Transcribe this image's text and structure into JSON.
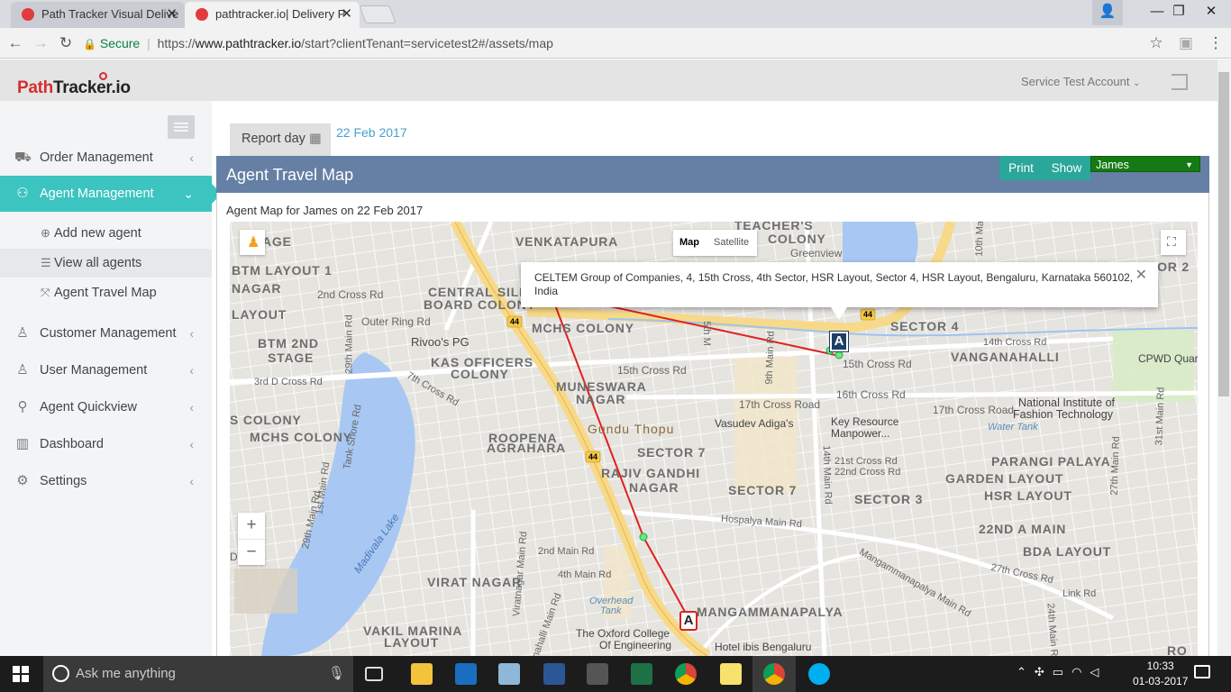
{
  "browser": {
    "tabs": [
      {
        "title": "Path Tracker Visual Delive",
        "active": false
      },
      {
        "title": "pathtracker.io| Delivery P",
        "active": true
      }
    ],
    "secure_label": "Secure",
    "url_scheme": "https://",
    "url_host": "www.pathtracker.io",
    "url_path": "/start?clientTenant=servicetest2#/assets/map"
  },
  "header": {
    "logo_path": "Path",
    "logo_tracker": "Tracker",
    "logo_io": ".io",
    "account": "Service Test Account"
  },
  "sidebar": {
    "items": [
      {
        "label": "Order Management",
        "icon": "truck-icon"
      },
      {
        "label": "Agent Management",
        "icon": "agents-icon",
        "active": true
      },
      {
        "label": "Customer Management",
        "icon": "user-icon"
      },
      {
        "label": "User Management",
        "icon": "user-icon"
      },
      {
        "label": "Agent Quickview",
        "icon": "motorbike-icon"
      },
      {
        "label": "Dashboard",
        "icon": "bar-chart-icon"
      },
      {
        "label": "Settings",
        "icon": "gear-icon"
      }
    ],
    "subitems": [
      {
        "label": "Add new agent",
        "icon": "plus-circle-icon"
      },
      {
        "label": "View all agents",
        "icon": "list-icon"
      },
      {
        "label": "Agent Travel Map",
        "icon": "expand-icon"
      }
    ]
  },
  "report": {
    "label": "Report day",
    "date": "22 Feb 2017"
  },
  "panel": {
    "title": "Agent Travel Map",
    "print": "Print",
    "show": "Show",
    "agent_selected": "James",
    "subtitle": "Agent Map for James on 22 Feb 2017"
  },
  "map": {
    "type_map": "Map",
    "type_satellite": "Satellite",
    "infowindow": "CELTEM Group of Companies, 4, 15th Cross, 4th Sector, HSR Layout, Sector 4, HSR Layout, Bengaluru, Karnataka 560102, India",
    "marker_label": "A",
    "road_badge": "44",
    "route_color": "#e02020",
    "labels": {
      "venkatapura": "VENKATAPURA",
      "teachers": "TEACHER'S",
      "colony1": "COLONY",
      "greenview": "Greenview",
      "btm1": "BTM LAYOUT 1",
      "nagar1": "NAGAR",
      "layout1": "LAYOUT",
      "age": "AGE",
      "central_silk": "CENTRAL SILK",
      "board_colony": "BOARD COLONY",
      "mchs1": "MCHS COLONY",
      "sector4": "SECTOR 4",
      "sector2": "TOR 2",
      "btm2": "BTM 2ND",
      "stage": "STAGE",
      "rivoos": "Rivoo's PG",
      "kas": "KAS OFFICERS",
      "kas_colony": "COLONY",
      "vanganahalli": "VANGANAHALLI",
      "cpwd": "CPWD Quar",
      "muneswara": "MUNESWARA",
      "muneswara2": "NAGAR",
      "colony_s": "S COLONY",
      "mchs2": "MCHS COLONY",
      "gundu": "Gundu Thopu",
      "vasudev": "Vasudev Adiga's",
      "keyres": "Key Resource",
      "keyres2": "Manpower...",
      "nift": "National Institute of",
      "nift2": "Fashion Technology",
      "watertank": "Water Tank",
      "roopena": "ROOPENA",
      "roopena2": "AGRAHARA",
      "sector7a": "SECTOR 7",
      "rajiv": "RAJIV GANDHI",
      "rajiv2": "NAGAR",
      "sector7b": "SECTOR 7",
      "sector3": "SECTOR 3",
      "parangi": "PARANGI PALAYA",
      "garden": "GARDEN LAYOUT",
      "hsr": "HSR LAYOUT",
      "a22": "22ND A MAIN",
      "bda": "BDA LAYOUT",
      "virat": "VIRAT NAGAR",
      "madivala": "Madivala Lake",
      "mangamma": "MANGAMMANAPALYA",
      "vakil": "VAKIL MARINA",
      "vakil2": "LAYOUT",
      "oxford": "The Oxford College",
      "oxford2": "Of Engineering",
      "ibis": "Hotel ibis Bengaluru",
      "overhead": "Overhead",
      "overhead2": "Tank",
      "ro": "RO",
      "di": "DI",
      "r2ndcross": "2nd Cross Rd",
      "outerring": "Outer Ring Rd",
      "r15th": "15th Cross Rd",
      "r17th": "17th Cross Road",
      "r16th": "16th Cross Rd",
      "r14thc": "14th Cross Rd",
      "r17thb": "17th Cross Road",
      "r21": "21st Cross Rd",
      "r22": "22nd Cross Rd",
      "r3rd": "3rd D Cross Rd",
      "r7th": "7th Cross Rd",
      "hospalya": "Hospalya Main Rd",
      "r2ndmain": "2nd Main Rd",
      "r4th": "4th Main Rd",
      "mangarod": "Mangammanapalya Main Rd",
      "r27": "27th Cross Rd",
      "link": "Link Rd",
      "r29": "29th Main Rd",
      "tankshore": "Tank Shore Rd",
      "r14main": "14th Main Rd",
      "r9main": "9th Main Rd",
      "r27main": "27th Main Rd",
      "r31main": "31st Main Rd",
      "r24main": "24th Main Rd",
      "r5main": "5th Main Rd",
      "viratnagar": "Viratnagar Main Rd",
      "sikkanahalli": "Sikkanahalli Main Rd",
      "r29b": "29th Main Rd",
      "r1main": "1st Main Rd",
      "r10main": "10th Main Rd",
      "r15b": "15th Cross Rd",
      "r5thm": "5th M"
    }
  },
  "taskbar": {
    "search_placeholder": "Ask me anything",
    "time": "10:33",
    "date": "01-03-2017"
  }
}
